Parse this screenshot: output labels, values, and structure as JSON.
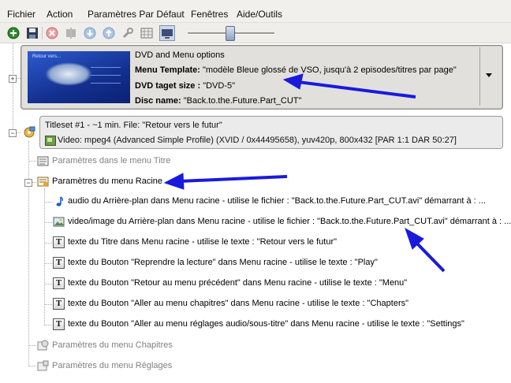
{
  "menubar": {
    "items": [
      "Fichier",
      "Action",
      "Paramètres Par Défaut",
      "Fenêtres",
      "Aide/Outils"
    ]
  },
  "toolbar": {
    "icons": [
      "add-icon",
      "save-icon",
      "delete-icon",
      "split-icon",
      "move-down-icon",
      "move-up-icon",
      "settings-icon",
      "grid-icon",
      "preview-icon"
    ],
    "zoom_slider_level": 0.48
  },
  "dvd_menu": {
    "header": "DVD and Menu options",
    "template_label": "Menu Template:",
    "template_value": " \"modèle Bleue glossé de VSO, jusqu'à 2 episodes/titres par page\"",
    "size_label": "DVD taget size :",
    "size_value": " \"DVD-5\"",
    "disc_label": "Disc name:",
    "disc_value": " \"Back.to.the.Future.Part_CUT\"",
    "thumb_title": "Retour vers..."
  },
  "titleset": {
    "line1": "Titleset #1 - ~1 min. File: \"Retour vers le futur\"",
    "line2": "Video: mpeg4 (Advanced Simple Profile) (XVID / 0x44495658), yuv420p, 800x432 [PAR 1:1 DAR 50:27]"
  },
  "tree": {
    "title_menu_params": "Paramètres dans le menu Titre",
    "root_menu_params": "Paramètres du menu Racine",
    "root_children": [
      "audio du Arrière-plan dans Menu racine - utilise le fichier : \"Back.to.the.Future.Part_CUT.avi\" démarrant à : ...",
      "video/image du Arrière-plan dans Menu racine - utilise le fichier : \"Back.to.the.Future.Part_CUT.avi\" démarrant à : ...",
      "texte du Titre dans Menu racine - utilise le texte : \"Retour vers le futur\"",
      "texte du Bouton \"Reprendre la lecture\" dans Menu racine - utilise le texte : \"Play\"",
      "texte du Bouton \"Retour au menu précédent\" dans Menu racine - utilise le texte : \"Menu\"",
      "texte du Bouton \"Aller au menu chapitres\" dans Menu racine - utilise le texte : \"Chapters\"",
      "texte du Bouton \"Aller au menu réglages audio/sous-titre\" dans Menu racine - utilise le texte : \"Settings\""
    ],
    "chapters_menu_params": "Paramètres du menu Chapitres",
    "settings_menu_params": "Paramètres du menu Réglages"
  },
  "colors": {
    "annotation_arrow": "#1a1adc",
    "window_bg": "#f1f0ec"
  }
}
